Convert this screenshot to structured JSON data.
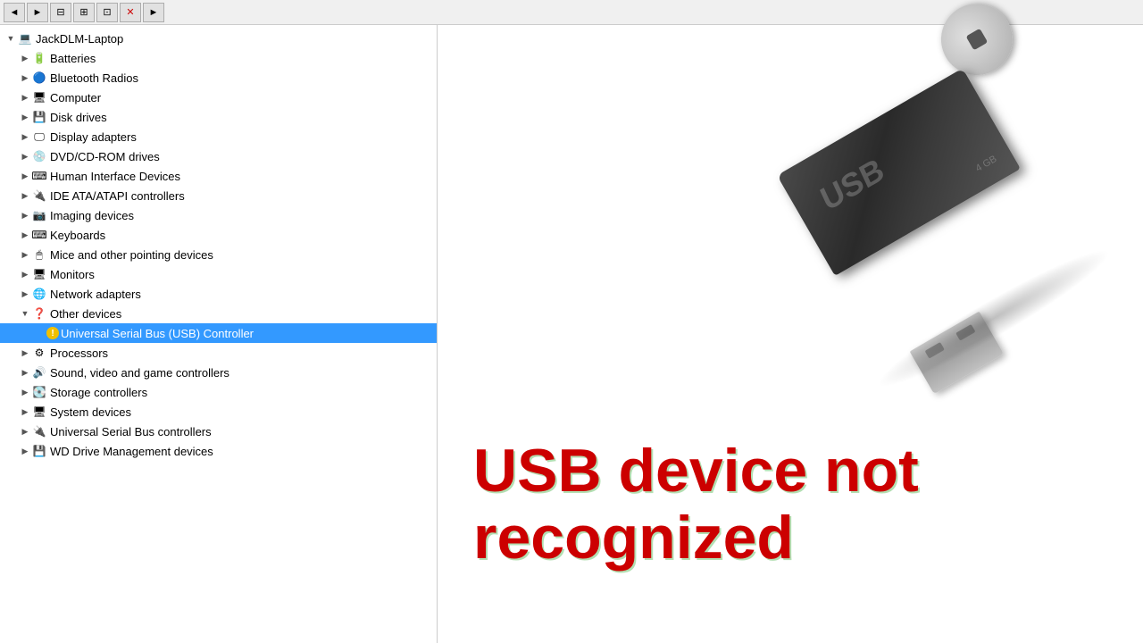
{
  "toolbar": {
    "buttons": [
      "◄",
      "►",
      "⊟",
      "⊞",
      "⊡",
      "✕",
      "►"
    ]
  },
  "tree": {
    "root": {
      "label": "JackDLM-Laptop",
      "icon": "💻",
      "expanded": true
    },
    "items": [
      {
        "id": "batteries",
        "label": "Batteries",
        "icon": "🔋",
        "indent": 1,
        "expanded": false,
        "expander": "▶"
      },
      {
        "id": "bluetooth",
        "label": "Bluetooth Radios",
        "icon": "📡",
        "indent": 1,
        "expanded": false,
        "expander": "▶"
      },
      {
        "id": "computer",
        "label": "Computer",
        "icon": "🖥",
        "indent": 1,
        "expanded": false,
        "expander": "▶"
      },
      {
        "id": "disk-drives",
        "label": "Disk drives",
        "icon": "💾",
        "indent": 1,
        "expanded": false,
        "expander": "▶"
      },
      {
        "id": "display-adapters",
        "label": "Display adapters",
        "icon": "🖵",
        "indent": 1,
        "expanded": false,
        "expander": "▶"
      },
      {
        "id": "dvd",
        "label": "DVD/CD-ROM drives",
        "icon": "💿",
        "indent": 1,
        "expanded": false,
        "expander": "▶"
      },
      {
        "id": "hid",
        "label": "Human Interface Devices",
        "icon": "⌨",
        "indent": 1,
        "expanded": false,
        "expander": "▶"
      },
      {
        "id": "ide",
        "label": "IDE ATA/ATAPI controllers",
        "icon": "🔌",
        "indent": 1,
        "expanded": false,
        "expander": "▶"
      },
      {
        "id": "imaging",
        "label": "Imaging devices",
        "icon": "📷",
        "indent": 1,
        "expanded": false,
        "expander": "▶"
      },
      {
        "id": "keyboards",
        "label": "Keyboards",
        "icon": "⌨",
        "indent": 1,
        "expanded": false,
        "expander": "▶"
      },
      {
        "id": "mice",
        "label": "Mice and other pointing devices",
        "icon": "🖱",
        "indent": 1,
        "expanded": false,
        "expander": "▶"
      },
      {
        "id": "monitors",
        "label": "Monitors",
        "icon": "🖥",
        "indent": 1,
        "expanded": false,
        "expander": "▶"
      },
      {
        "id": "network",
        "label": "Network adapters",
        "icon": "🌐",
        "indent": 1,
        "expanded": false,
        "expander": "▶"
      },
      {
        "id": "other",
        "label": "Other devices",
        "icon": "❓",
        "indent": 1,
        "expanded": true,
        "expander": "▼"
      },
      {
        "id": "usb-controller",
        "label": "Universal Serial Bus (USB) Controller",
        "icon": "⚠",
        "indent": 2,
        "expanded": false,
        "expander": "",
        "selected": true,
        "warning": true
      },
      {
        "id": "processors",
        "label": "Processors",
        "icon": "⚙",
        "indent": 1,
        "expanded": false,
        "expander": "▶"
      },
      {
        "id": "sound",
        "label": "Sound, video and game controllers",
        "icon": "🔊",
        "indent": 1,
        "expanded": false,
        "expander": "▶"
      },
      {
        "id": "storage",
        "label": "Storage controllers",
        "icon": "💽",
        "indent": 1,
        "expanded": false,
        "expander": "▶"
      },
      {
        "id": "system",
        "label": "System devices",
        "icon": "🖥",
        "indent": 1,
        "expanded": false,
        "expander": "▶"
      },
      {
        "id": "usb-controllers",
        "label": "Universal Serial Bus controllers",
        "icon": "🔌",
        "indent": 1,
        "expanded": false,
        "expander": "▶"
      },
      {
        "id": "wd-drive",
        "label": "WD Drive Management devices",
        "icon": "💾",
        "indent": 1,
        "expanded": false,
        "expander": "▶"
      }
    ]
  },
  "error_message": {
    "line1": "USB device not",
    "line2": "recognized"
  }
}
